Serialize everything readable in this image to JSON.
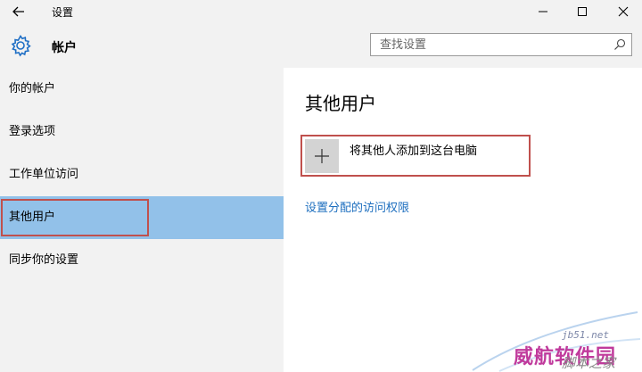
{
  "window": {
    "title": "设置",
    "minimize_label": "minimize",
    "maximize_label": "maximize",
    "close_label": "close"
  },
  "header": {
    "title": "帐户",
    "search": {
      "placeholder": "查找设置",
      "value": ""
    }
  },
  "sidebar": {
    "items": [
      {
        "label": "你的帐户",
        "active": false
      },
      {
        "label": "登录选项",
        "active": false
      },
      {
        "label": "工作单位访问",
        "active": false
      },
      {
        "label": "其他用户",
        "active": true
      },
      {
        "label": "同步你的设置",
        "active": false
      }
    ]
  },
  "main": {
    "title": "其他用户",
    "add_user_label": "将其他人添加到这台电脑",
    "assigned_access_link": "设置分配的访问权限"
  },
  "watermark": {
    "site": "jb51.net",
    "brand": "威航软件园",
    "tagline": "脚本之家"
  },
  "colors": {
    "accent": "#92c1e9",
    "highlight_box": "#c0504d",
    "link": "#1e6fbf",
    "background": "#f2f2f2"
  }
}
